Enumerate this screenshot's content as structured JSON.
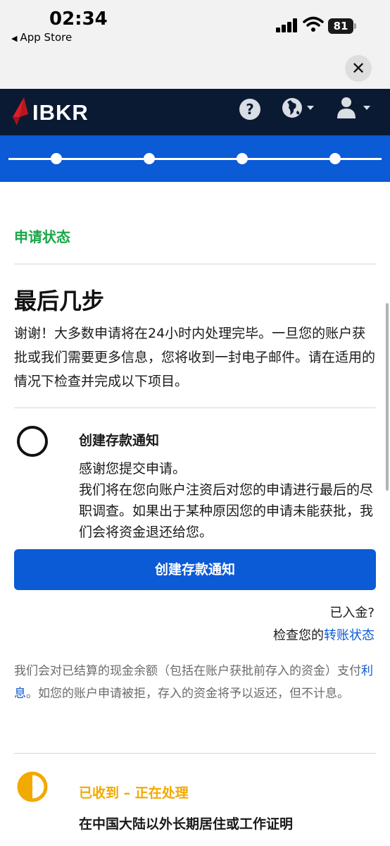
{
  "status_bar": {
    "time": "02:34",
    "back_app": "App Store",
    "battery": "81"
  },
  "header": {
    "logo_text": "IBKR",
    "help_glyph": "?"
  },
  "progress": {
    "steps": 4
  },
  "content": {
    "section_label": "申请状态",
    "heading": "最后几步",
    "intro": "谢谢！大多数申请将在24小时内处理完毕。一旦您的账户获批或我们需要更多信息，您将收到一封电子邮件。请在适用的情况下检查并完成以下项目。"
  },
  "task_deposit": {
    "title": "创建存款通知",
    "body_line1": "感谢您提交申请。",
    "body_line2": "我们将在您向账户注资后对您的申请进行最后的尽职调查。如果出于某种原因您的申请未能获批，我们会将资金退还给您。",
    "button_label": "创建存款通知",
    "deposited_question": "已入金?",
    "check_prefix": "检查您的",
    "check_link": "转账状态"
  },
  "interest_note": {
    "part1": "我们会对已结算的现金余额（包括在账户获批前存入的资金）支付",
    "link": "利息",
    "part2": "。如您的账户申请被拒，存入的资金将予以返还，但不计息。"
  },
  "task_residency": {
    "status": "已收到 – 正在处理",
    "title": "在中国大陆以外长期居住或工作证明"
  },
  "colors": {
    "brand_navy": "#0b1a33",
    "brand_blue": "#0b5ad6",
    "brand_red": "#d81e2a",
    "success_green": "#1aa64b",
    "pending_amber": "#f2a900"
  }
}
